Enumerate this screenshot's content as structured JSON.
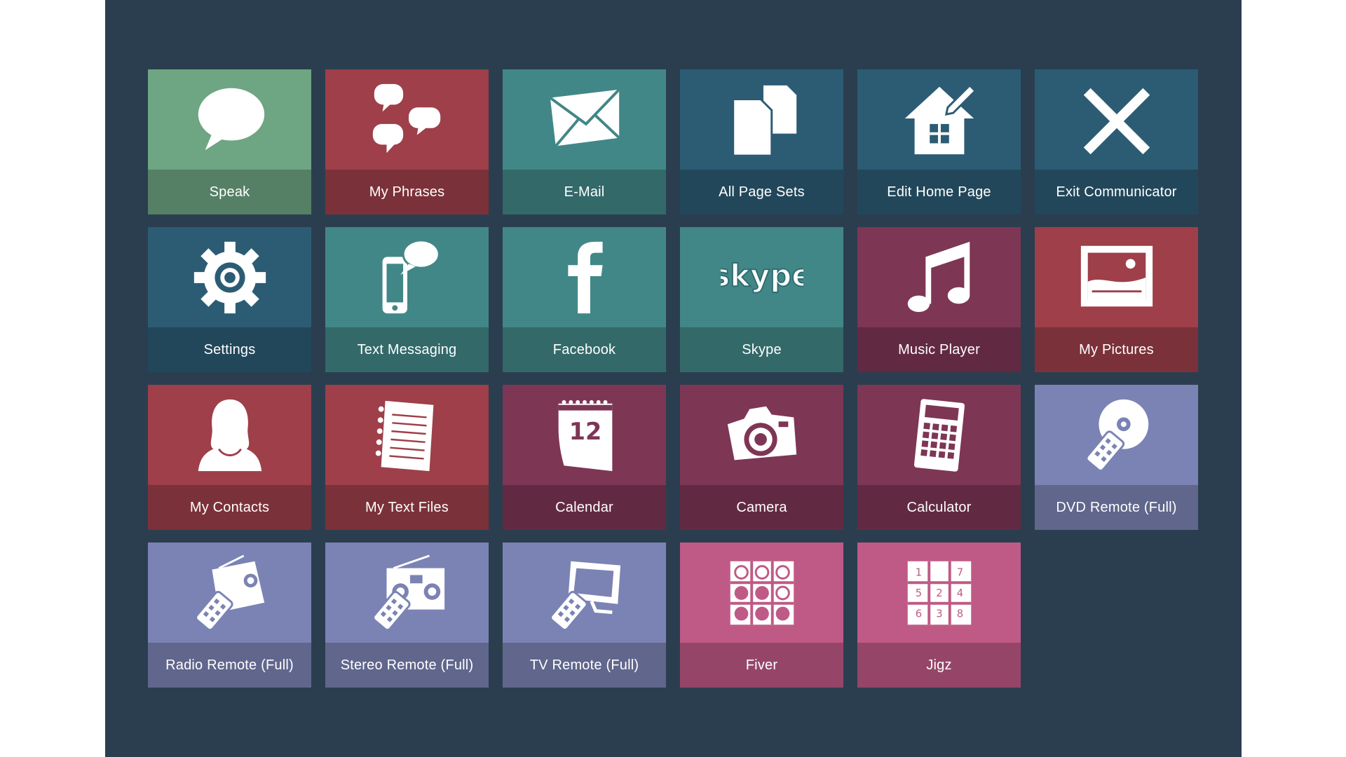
{
  "app": {
    "background_color": "#2b3e4f",
    "tiles": [
      {
        "label": "Speak",
        "icon": "speech-bubble-icon",
        "color": "#6ea582"
      },
      {
        "label": "My Phrases",
        "icon": "chat-bubbles-icon",
        "color": "#9e3f4a"
      },
      {
        "label": "E-Mail",
        "icon": "envelope-icon",
        "color": "#428787"
      },
      {
        "label": "All Page Sets",
        "icon": "documents-icon",
        "color": "#2c5c74"
      },
      {
        "label": "Edit Home Page",
        "icon": "house-pencil-icon",
        "color": "#2c5c74"
      },
      {
        "label": "Exit Communicator",
        "icon": "close-x-icon",
        "color": "#2c5c74"
      },
      {
        "label": "Settings",
        "icon": "gear-icon",
        "color": "#2c5c74"
      },
      {
        "label": "Text Messaging",
        "icon": "phone-message-icon",
        "color": "#428787"
      },
      {
        "label": "Facebook",
        "icon": "facebook-icon",
        "color": "#428787"
      },
      {
        "label": "Skype",
        "icon": "skype-icon",
        "color": "#428787"
      },
      {
        "label": "Music Player",
        "icon": "music-note-icon",
        "color": "#7e3655"
      },
      {
        "label": "My Pictures",
        "icon": "picture-frame-icon",
        "color": "#9e3f4a"
      },
      {
        "label": "My Contacts",
        "icon": "contact-person-icon",
        "color": "#9e3f4a"
      },
      {
        "label": "My Text Files",
        "icon": "notebook-icon",
        "color": "#9e3f4a"
      },
      {
        "label": "Calendar",
        "icon": "calendar-icon",
        "color": "#7e3655"
      },
      {
        "label": "Camera",
        "icon": "camera-icon",
        "color": "#7e3655"
      },
      {
        "label": "Calculator",
        "icon": "calculator-icon",
        "color": "#7e3655"
      },
      {
        "label": "DVD Remote (Full)",
        "icon": "dvd-remote-icon",
        "color": "#7b83b4"
      },
      {
        "label": "Radio Remote (Full)",
        "icon": "radio-remote-icon",
        "color": "#7b83b4"
      },
      {
        "label": "Stereo Remote (Full)",
        "icon": "stereo-remote-icon",
        "color": "#7b83b4"
      },
      {
        "label": "TV Remote (Full)",
        "icon": "tv-remote-icon",
        "color": "#7b83b4"
      },
      {
        "label": "Fiver",
        "icon": "fiver-grid-icon",
        "color": "#bf5a86"
      },
      {
        "label": "Jigz",
        "icon": "jigz-grid-icon",
        "color": "#bf5a86"
      }
    ],
    "calendar_number": "12",
    "jigz_numbers": [
      "1",
      "",
      "7",
      "5",
      "2",
      "4",
      "6",
      "3",
      "8"
    ]
  }
}
